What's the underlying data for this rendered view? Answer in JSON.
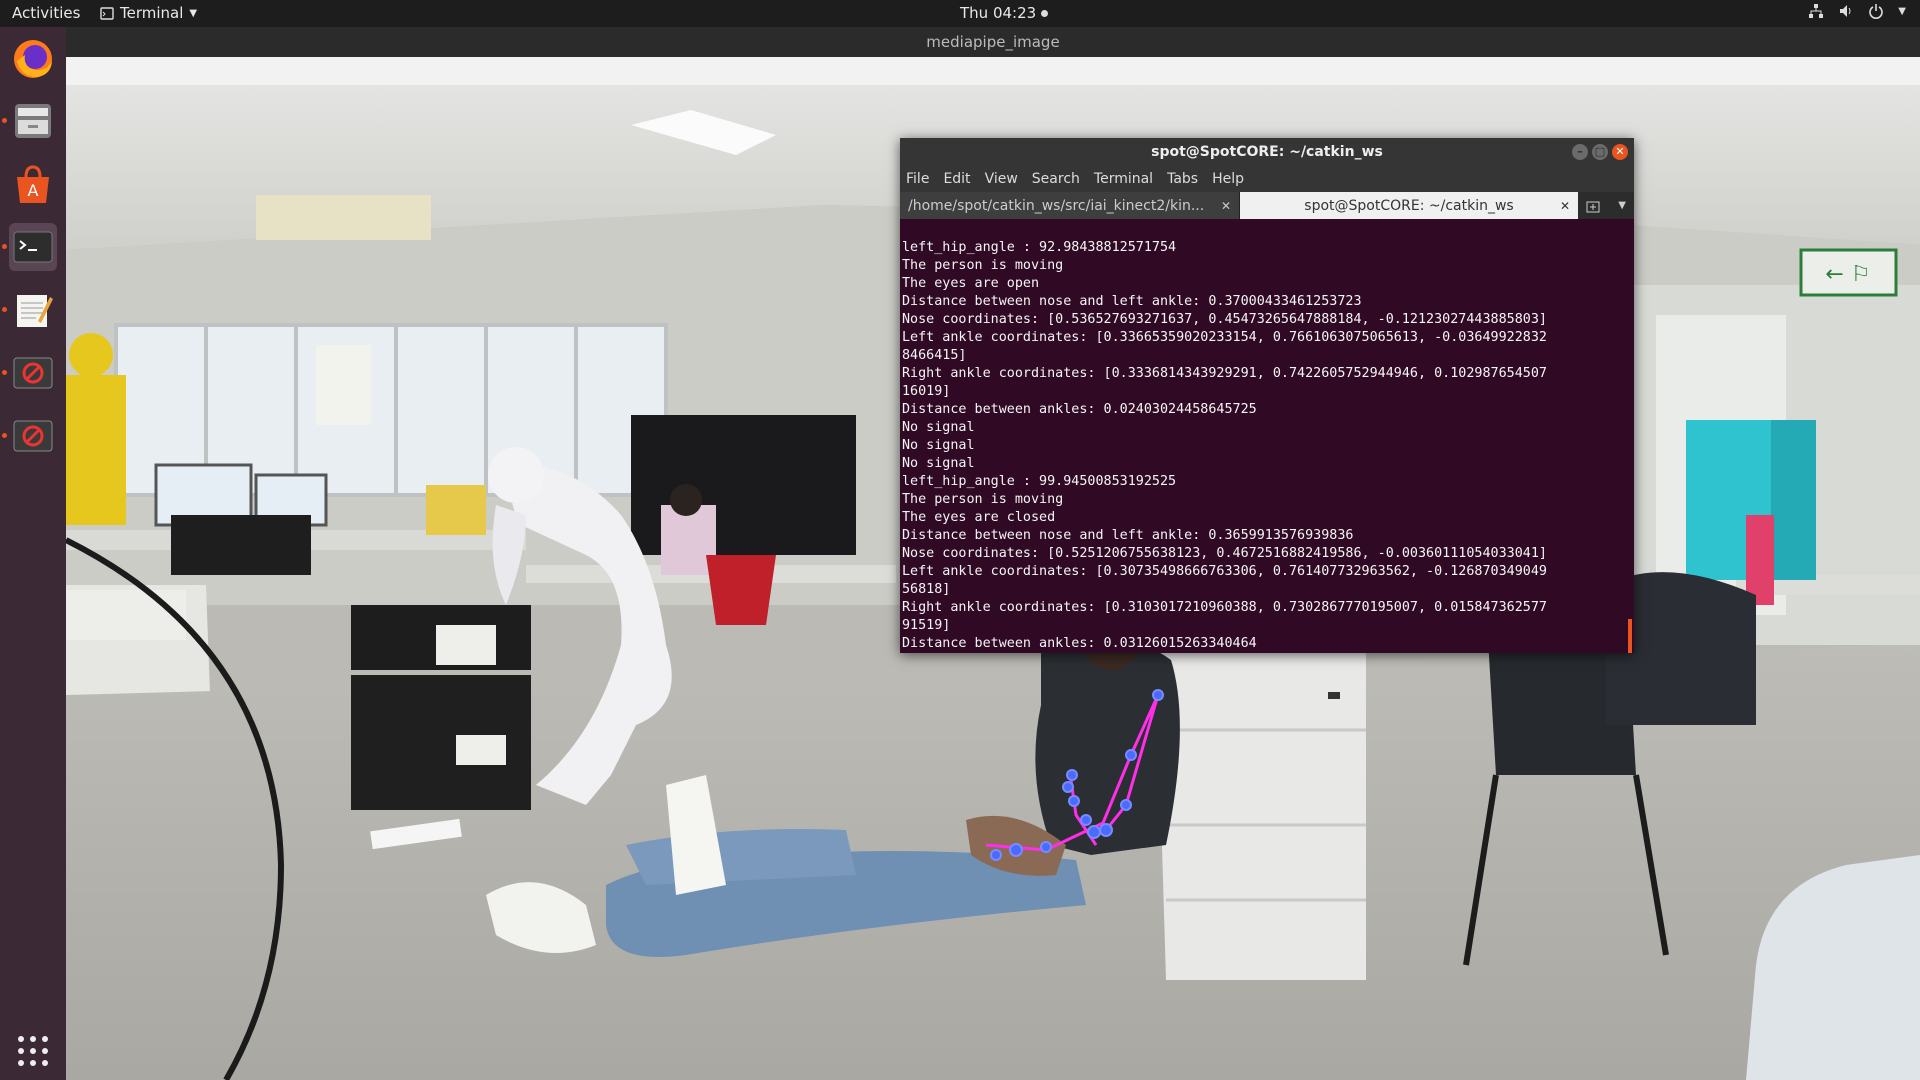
{
  "topbar": {
    "activities": "Activities",
    "app_name": "Terminal",
    "clock": "Thu 04:23"
  },
  "dock": {
    "items": [
      "Firefox",
      "Files",
      "Ubuntu Software",
      "Terminal",
      "Text Editor",
      "Blocked App",
      "Blocked App"
    ]
  },
  "image_window": {
    "title": "mediapipe_image"
  },
  "terminal": {
    "title": "spot@SpotCORE: ~/catkin_ws",
    "menu": [
      "File",
      "Edit",
      "View",
      "Search",
      "Terminal",
      "Tabs",
      "Help"
    ],
    "tabs": [
      {
        "label": "/home/spot/catkin_ws/src/iai_kinect2/kin...",
        "active": false
      },
      {
        "label": "spot@SpotCORE: ~/catkin_ws",
        "active": true
      }
    ],
    "lines": [
      "left_hip_angle : 92.98438812571754",
      "The person is moving",
      "The eyes are open",
      "Distance between nose and left ankle: 0.37000433461253723",
      "Nose coordinates: [0.536527693271637, 0.45473265647888184, -0.12123027443885803]",
      "Left ankle coordinates: [0.33665359020233154, 0.7661063075065613, -0.03649922832",
      "8466415]",
      "Right ankle coordinates: [0.3336814343929291, 0.7422605752944946, 0.102987654507",
      "16019]",
      "Distance between ankles: 0.02403024458645725",
      "No signal",
      "No signal",
      "No signal",
      "left_hip_angle : 99.94500853192525",
      "The person is moving",
      "The eyes are closed",
      "Distance between nose and left ankle: 0.3659913576939836",
      "Nose coordinates: [0.5251206755638123, 0.4672516882419586, -0.00360111054033041]",
      "Left ankle coordinates: [0.30735498666763306, 0.761407732963562, -0.126870349049",
      "56818]",
      "Right ankle coordinates: [0.3103017210960388, 0.7302867770195007, 0.015847362577",
      "91519]",
      "Distance between ankles: 0.03126015263340464"
    ]
  },
  "colors": {
    "terminal_bg": "#300a24",
    "accent": "#e95420",
    "pose_lines": "#ff2ee8",
    "pose_points": "#4a6bff"
  }
}
